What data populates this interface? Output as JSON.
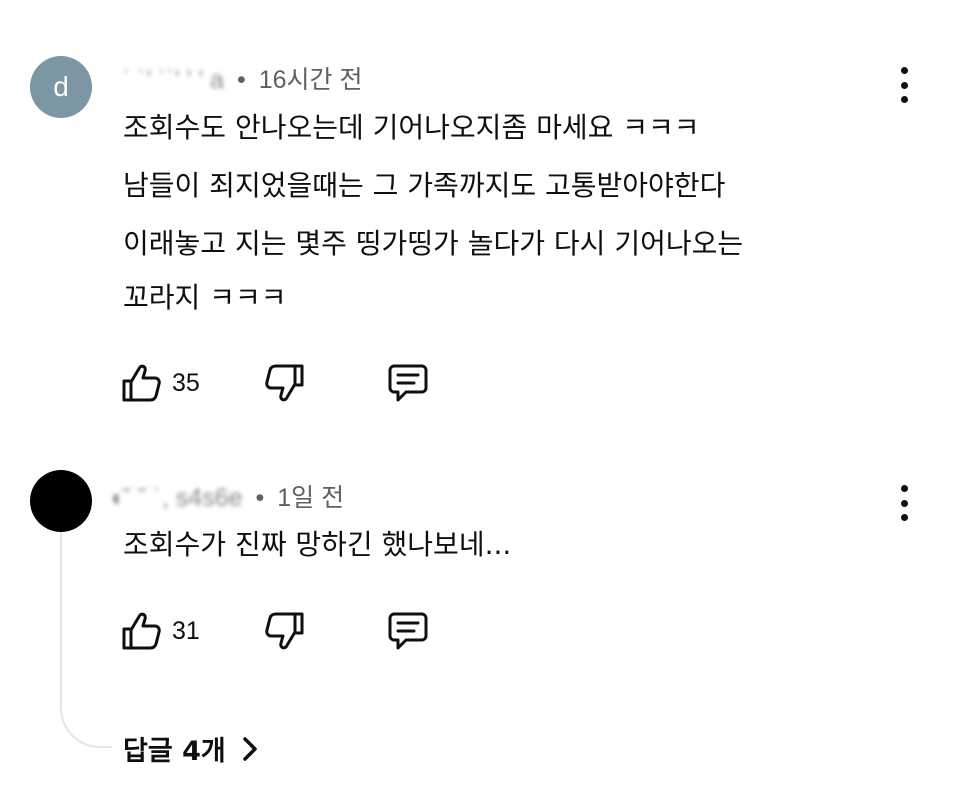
{
  "comments": [
    {
      "avatar_letter": "d",
      "avatar_color": "#7c96a3",
      "author": "˙ ˙' ˙˙' ' ' a",
      "time": "16시간 전",
      "lines": [
        "조회수도 안나오는데 기어나오지좀 마세요 ㅋㅋㅋ",
        "남들이 죄지었을때는 그 가족까지도 고통받아야한다",
        "이래놓고 지는 몇주 띵가띵가 놀다가 다시 기어나오는",
        "꼬라지 ㅋㅋㅋ"
      ],
      "likes": "35",
      "icons": {
        "like": "thumbs-up-icon",
        "dislike": "thumbs-down-icon",
        "reply": "comment-icon",
        "menu": "more-vert-icon"
      }
    },
    {
      "avatar_letter": "",
      "avatar_color": "#000000",
      "author": "◖˘ ˘ ˙, s4s6e",
      "time": "1일 전",
      "lines": [
        "조회수가 진짜 망하긴 했나보네..."
      ],
      "likes": "31",
      "icons": {
        "like": "thumbs-up-icon",
        "dislike": "thumbs-down-icon",
        "reply": "comment-icon",
        "menu": "more-vert-icon"
      }
    }
  ],
  "separator": "•",
  "replies_label": "답글 4개",
  "replies_icon": "chevron-right-icon",
  "thread_line_color": "#e5e5e5"
}
